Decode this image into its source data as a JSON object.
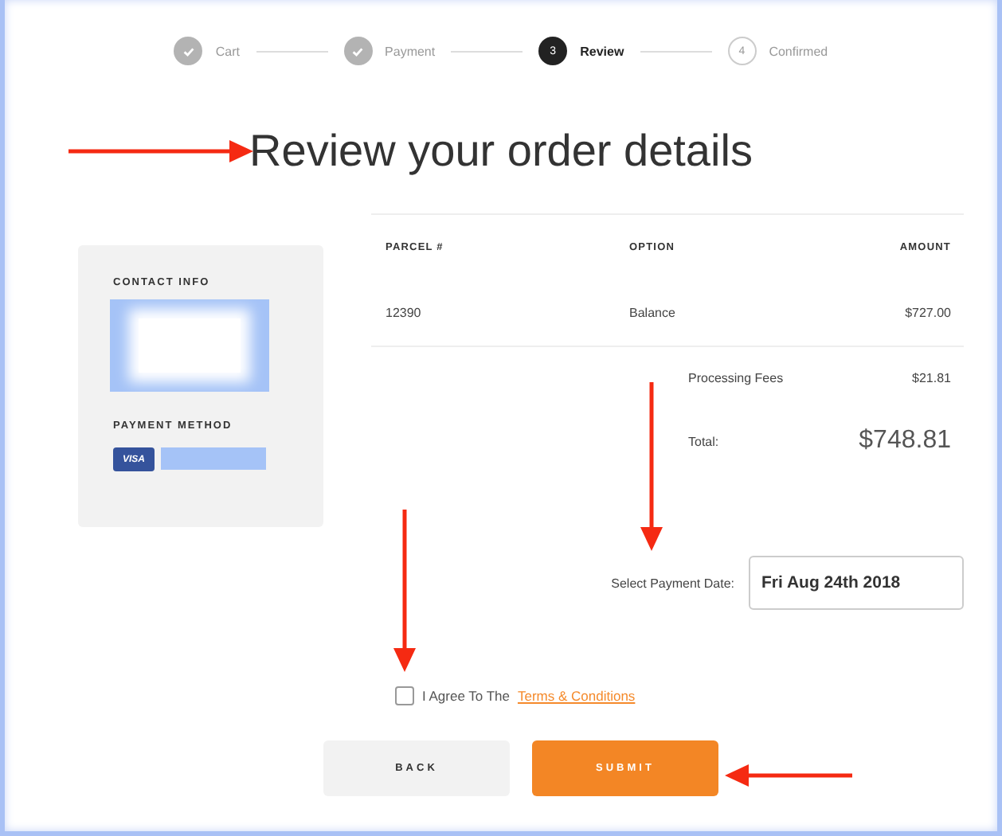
{
  "steps": [
    {
      "label": "Cart",
      "completed": true,
      "selected": false
    },
    {
      "label": "Payment",
      "completed": true,
      "selected": false
    },
    {
      "label": "Review",
      "number": "3",
      "completed": false,
      "selected": true
    },
    {
      "label": "Confirmed",
      "number": "4",
      "completed": false,
      "selected": false
    }
  ],
  "title": "Review your order details",
  "summary": {
    "contact_label": "CONTACT INFO",
    "payment_label": "PAYMENT METHOD",
    "card_brand": "VISA"
  },
  "table": {
    "columns": [
      "PARCEL #",
      "OPTION",
      "AMOUNT"
    ],
    "rows": [
      [
        "12390",
        "Balance",
        "$727.00"
      ]
    ]
  },
  "fees": {
    "label": "Processing Fees",
    "value": "$21.81"
  },
  "total": {
    "label": "Total:",
    "value": "$748.81"
  },
  "date": {
    "label": "Select Payment Date:",
    "value": "Fri Aug 24th 2018"
  },
  "agree": {
    "checked": false,
    "text": "I Agree To The",
    "link": "Terms & Conditions"
  },
  "buttons": [
    {
      "label": "BACK",
      "kind": "secondary"
    },
    {
      "label": "SUBMIT",
      "kind": "primary"
    }
  ]
}
